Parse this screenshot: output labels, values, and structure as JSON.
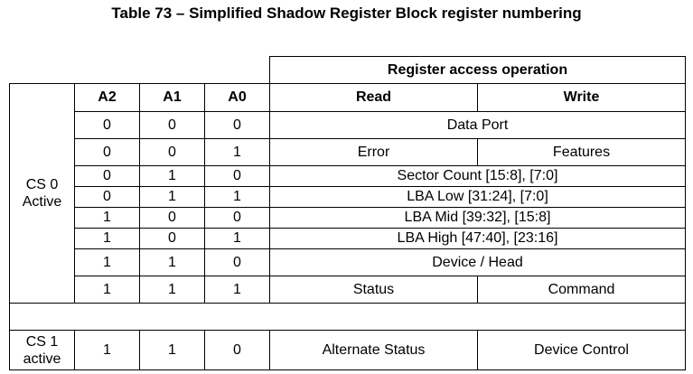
{
  "title": "Table 73 – Simplified Shadow Register Block register numbering",
  "table": {
    "group_header": "Register access operation",
    "headers": {
      "a2": "A2",
      "a1": "A1",
      "a0": "A0",
      "read": "Read",
      "write": "Write"
    },
    "cs0_label_line1": "CS 0",
    "cs0_label_line2": "Active",
    "cs1_label_line1": "CS 1",
    "cs1_label_line2": "active",
    "rows": [
      {
        "a2": "0",
        "a1": "0",
        "a0": "0",
        "both": "Data Port"
      },
      {
        "a2": "0",
        "a1": "0",
        "a0": "1",
        "read": "Error",
        "write": "Features"
      },
      {
        "a2": "0",
        "a1": "1",
        "a0": "0",
        "both": "Sector Count [15:8], [7:0]"
      },
      {
        "a2": "0",
        "a1": "1",
        "a0": "1",
        "both": "LBA Low [31:24], [7:0]"
      },
      {
        "a2": "1",
        "a1": "0",
        "a0": "0",
        "both": "LBA Mid [39:32], [15:8]"
      },
      {
        "a2": "1",
        "a1": "0",
        "a0": "1",
        "both": "LBA High [47:40], [23:16]"
      },
      {
        "a2": "1",
        "a1": "1",
        "a0": "0",
        "both": "Device / Head"
      },
      {
        "a2": "1",
        "a1": "1",
        "a0": "1",
        "read": "Status",
        "write": "Command"
      }
    ],
    "cs1_row": {
      "a2": "1",
      "a1": "1",
      "a0": "0",
      "read": "Alternate Status",
      "write": "Device Control"
    }
  }
}
